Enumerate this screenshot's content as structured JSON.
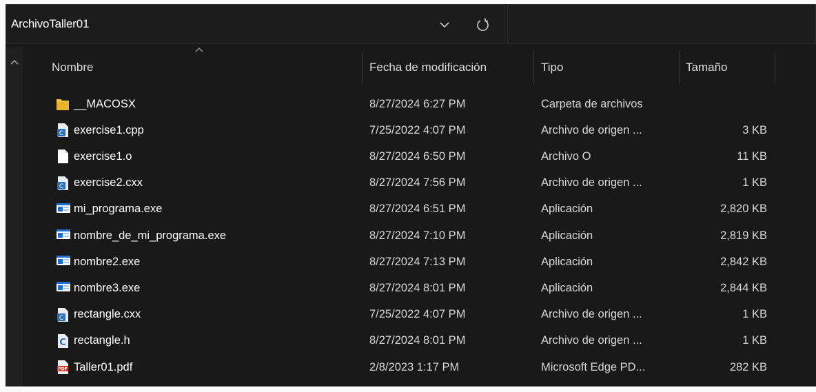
{
  "address_bar": {
    "path": "ArchivoTaller01"
  },
  "columns": {
    "name": "Nombre",
    "date": "Fecha de modificación",
    "type": "Tipo",
    "size": "Tamaño"
  },
  "files": [
    {
      "name": "__MACOSX",
      "date": "8/27/2024 6:27 PM",
      "type": "Carpeta de archivos",
      "size": "",
      "icon": "folder-icon"
    },
    {
      "name": "exercise1.cpp",
      "date": "7/25/2022 4:07 PM",
      "type": "Archivo de origen ...",
      "size": "3 KB",
      "icon": "cpp-source-icon"
    },
    {
      "name": "exercise1.o",
      "date": "8/27/2024 6:50 PM",
      "type": "Archivo O",
      "size": "11 KB",
      "icon": "generic-file-icon"
    },
    {
      "name": "exercise2.cxx",
      "date": "8/27/2024 7:56 PM",
      "type": "Archivo de origen ...",
      "size": "1 KB",
      "icon": "cpp-source-icon"
    },
    {
      "name": "mi_programa.exe",
      "date": "8/27/2024 6:51 PM",
      "type": "Aplicación",
      "size": "2,820 KB",
      "icon": "application-icon"
    },
    {
      "name": "nombre_de_mi_programa.exe",
      "date": "8/27/2024 7:10 PM",
      "type": "Aplicación",
      "size": "2,819 KB",
      "icon": "application-icon"
    },
    {
      "name": "nombre2.exe",
      "date": "8/27/2024 7:13 PM",
      "type": "Aplicación",
      "size": "2,842 KB",
      "icon": "application-icon"
    },
    {
      "name": "nombre3.exe",
      "date": "8/27/2024 8:01 PM",
      "type": "Aplicación",
      "size": "2,844 KB",
      "icon": "application-icon"
    },
    {
      "name": "rectangle.cxx",
      "date": "7/25/2022 4:07 PM",
      "type": "Archivo de origen ...",
      "size": "1 KB",
      "icon": "cpp-source-icon"
    },
    {
      "name": "rectangle.h",
      "date": "8/27/2024 8:01 PM",
      "type": "Archivo de origen ...",
      "size": "1 KB",
      "icon": "c-header-icon"
    },
    {
      "name": "Taller01.pdf",
      "date": "2/8/2023 1:17 PM",
      "type": "Microsoft Edge PD...",
      "size": "282 KB",
      "icon": "pdf-icon"
    }
  ],
  "colors": {
    "background": "#191919",
    "text": "#ffffff",
    "folder": "#f4c441",
    "app_blue": "#1f6fd1",
    "pdf_red": "#d8352a"
  }
}
